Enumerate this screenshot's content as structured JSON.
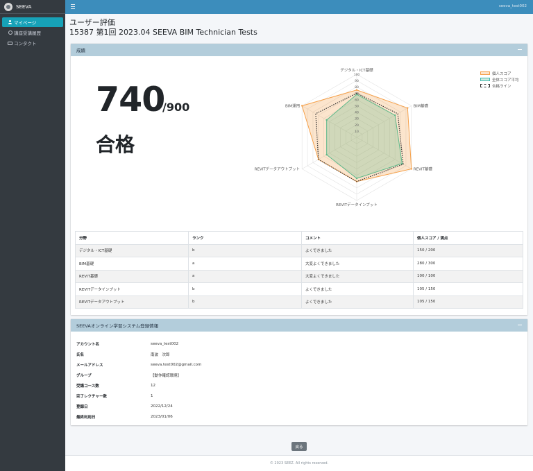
{
  "brand": {
    "name": "SEEVA"
  },
  "sidebar": {
    "items": [
      {
        "label": "マイページ",
        "icon": "user-icon",
        "active": true
      },
      {
        "label": "講座受講履歴",
        "icon": "history-icon"
      },
      {
        "label": "コンタクト",
        "icon": "mail-icon"
      }
    ]
  },
  "topbar": {
    "user": "seeva_test002"
  },
  "page": {
    "title": "ユーザー評価",
    "subtitle": "15387 第1回 2023.04 SEEVA BIM Technician Tests"
  },
  "results": {
    "card_title": "成績",
    "score": "740",
    "score_max": "/900",
    "verdict": "合格"
  },
  "chart_data": {
    "type": "radar",
    "axes": [
      "デジタル・ICT基礎",
      "BIM基礎",
      "REVIT基礎",
      "REVITデータインプット",
      "REVITデータアウトプット",
      "BIM運用"
    ],
    "ticks": [
      "10",
      "20",
      "30",
      "40",
      "50",
      "60",
      "70",
      "80",
      "90",
      "100"
    ],
    "range": [
      0,
      100
    ],
    "series": [
      {
        "name": "個人スコア",
        "values": [
          75,
          93,
          100,
          70,
          70,
          100
        ],
        "color": "#f5a04a"
      },
      {
        "name": "全体スコア平均",
        "values": [
          68,
          70,
          83,
          65,
          55,
          55
        ],
        "color": "#5cb88a"
      },
      {
        "name": "合格ライン",
        "values": [
          70,
          75,
          85,
          70,
          70,
          75
        ],
        "color": "#333333"
      }
    ],
    "legend_position": "top-right"
  },
  "table": {
    "headers": [
      "分野",
      "ランク",
      "コメント",
      "個人スコア / 満点"
    ],
    "rows": [
      [
        "デジタル・ICT基礎",
        "b",
        "よくできました",
        "150 / 200"
      ],
      [
        "BIM基礎",
        "a",
        "大変よくできました",
        "280 / 300"
      ],
      [
        "REVIT基礎",
        "a",
        "大変よくできました",
        "100 / 100"
      ],
      [
        "REVITデータインプット",
        "b",
        "よくできました",
        "105 / 150"
      ],
      [
        "REVITデータアウトプット",
        "b",
        "よくできました",
        "105 / 150"
      ]
    ]
  },
  "account": {
    "card_title": "SEEVAオンライン学習システム登録情報",
    "rows": [
      {
        "label": "アカウント名",
        "value": "seeva_test002"
      },
      {
        "label": "氏名",
        "value": "南波　次郎"
      },
      {
        "label": "メールアドレス",
        "value": "seeva.test002@gmail.com"
      },
      {
        "label": "グループ",
        "value": "【動作確認環境】"
      },
      {
        "label": "受講コース数",
        "value": "12"
      },
      {
        "label": "完了レクチャー数",
        "value": "1"
      },
      {
        "label": "登録日",
        "value": "2022/12/24"
      },
      {
        "label": "最終利用日",
        "value": "2023/01/06"
      }
    ]
  },
  "back_label": "戻る",
  "footer": "© 2023 SEEZ. All rights reserved."
}
